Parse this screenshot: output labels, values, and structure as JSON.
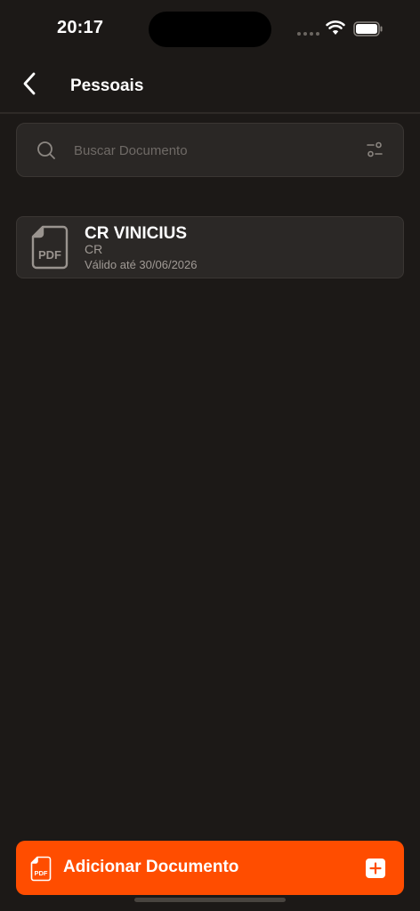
{
  "status_bar": {
    "time": "20:17"
  },
  "header": {
    "title": "Pessoais",
    "back_icon": "chevron-left-icon"
  },
  "search": {
    "placeholder": "Buscar Documento",
    "value": "",
    "icon": "search-icon",
    "filter_icon": "sliders-icon"
  },
  "documents": [
    {
      "title": "CR VINICIUS",
      "type": "CR",
      "validity": "Válido até 30/06/2026",
      "icon_label": "PDF"
    }
  ],
  "add_button": {
    "label": "Adicionar Documento",
    "icon_label": "PDF",
    "plus_icon": "plus-square-icon"
  },
  "colors": {
    "background": "#1c1917",
    "card": "#2b2826",
    "accent": "#ff4d00",
    "muted_text": "#a09a95"
  }
}
